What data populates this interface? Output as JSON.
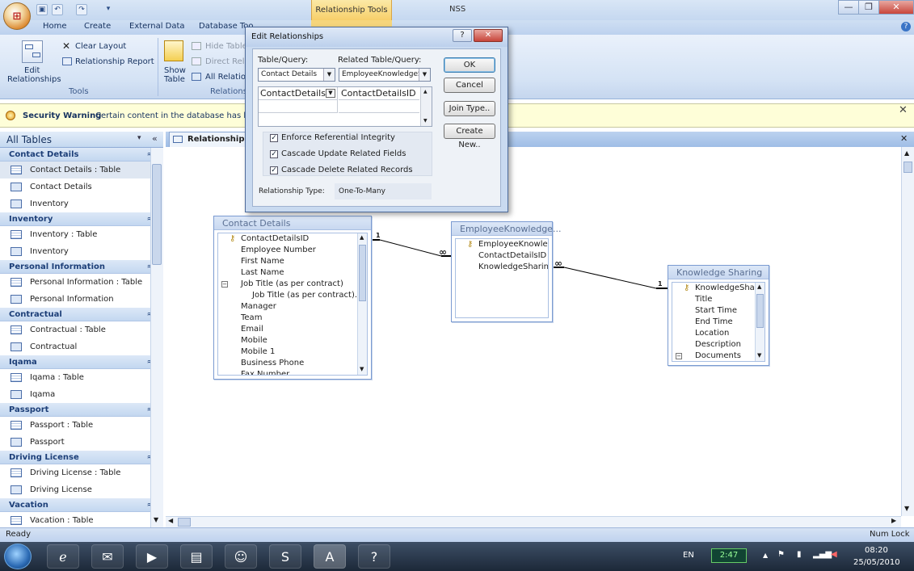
{
  "window": {
    "contextual_tab": "Relationship Tools",
    "app_title": "NSS",
    "buttons": {
      "minimize": "—",
      "restore": "❐",
      "close": "✕"
    }
  },
  "ribbon": {
    "tabs": [
      "Home",
      "Create",
      "External Data",
      "Database Too"
    ],
    "tools_group": {
      "clear_layout": "Clear Layout",
      "relationship_report": "Relationship Report",
      "edit_relationships_line1": "Edit",
      "edit_relationships_line2": "Relationships",
      "label": "Tools"
    },
    "relationships_group": {
      "hide_table": "Hide Table",
      "direct_relationships": "Direct Rela",
      "all_relationships": "All Relation",
      "show_table_line1": "Show",
      "show_table_line2": "Table",
      "label": "Relations"
    }
  },
  "security_bar": {
    "title": "Security Warning",
    "message": "Certain content in the database has been"
  },
  "nav": {
    "header": "All Tables",
    "groups": [
      {
        "name": "Contact Details",
        "items": [
          {
            "label": "Contact Details : Table",
            "kind": "table",
            "selected": true
          },
          {
            "label": "Contact Details",
            "kind": "form"
          },
          {
            "label": "Inventory",
            "kind": "form"
          }
        ]
      },
      {
        "name": "Inventory",
        "items": [
          {
            "label": "Inventory : Table",
            "kind": "table"
          },
          {
            "label": "Inventory",
            "kind": "form"
          }
        ]
      },
      {
        "name": "Personal Information",
        "items": [
          {
            "label": "Personal Information : Table",
            "kind": "table"
          },
          {
            "label": "Personal Information",
            "kind": "form"
          }
        ]
      },
      {
        "name": "Contractual",
        "items": [
          {
            "label": "Contractual : Table",
            "kind": "table"
          },
          {
            "label": "Contractual",
            "kind": "form"
          }
        ]
      },
      {
        "name": "Iqama",
        "items": [
          {
            "label": "Iqama : Table",
            "kind": "table"
          },
          {
            "label": "Iqama",
            "kind": "form"
          }
        ]
      },
      {
        "name": "Passport",
        "items": [
          {
            "label": "Passport : Table",
            "kind": "table"
          },
          {
            "label": "Passport",
            "kind": "form"
          }
        ]
      },
      {
        "name": "Driving License",
        "items": [
          {
            "label": "Driving License : Table",
            "kind": "table"
          },
          {
            "label": "Driving License",
            "kind": "form"
          }
        ]
      },
      {
        "name": "Vacation",
        "items": [
          {
            "label": "Vacation : Table",
            "kind": "table"
          }
        ]
      }
    ]
  },
  "document": {
    "tab_label": "Relationships"
  },
  "tables": {
    "contact_details": {
      "title": "Contact Details",
      "fields": [
        "ContactDetailsID",
        "Employee Number",
        "First Name",
        "Last Name",
        "Job Title (as per contract)",
        "Job Title (as per contract).Va",
        "Manager",
        "Team",
        "Email",
        "Mobile",
        "Mobile 1",
        "Business Phone",
        "Fax Number"
      ]
    },
    "employee_knowledge": {
      "title": "EmployeeKnowledge...",
      "fields": [
        "EmployeeKnowledg",
        "ContactDetailsID",
        "KnowledgeSharing"
      ]
    },
    "knowledge_sharing": {
      "title": "Knowledge Sharing",
      "fields": [
        "KnowledgeShar",
        "Title",
        "Start Time",
        "End Time",
        "Location",
        "Description",
        "Documents"
      ]
    }
  },
  "join_labels": {
    "one": "1",
    "many": "∞"
  },
  "dialog": {
    "title": "Edit Relationships",
    "help": "?",
    "close": "✕",
    "table_query_label": "Table/Query:",
    "related_table_query_label": "Related Table/Query:",
    "table_query_value": "Contact Details",
    "related_table_query_value": "EmployeeKnowledgeSh",
    "field_left": "ContactDetails",
    "field_right": "ContactDetailsID",
    "enforce_ri": "Enforce Referential Integrity",
    "cascade_update": "Cascade Update Related Fields",
    "cascade_delete": "Cascade Delete Related Records",
    "relationship_type_label": "Relationship Type:",
    "relationship_type_value": "One-To-Many",
    "ok": "OK",
    "cancel": "Cancel",
    "join_type": "Join Type..",
    "create_new": "Create New.."
  },
  "status_bar": {
    "left": "Ready",
    "right": "Num Lock"
  },
  "taskbar": {
    "language": "EN",
    "battery": "2:47",
    "time": "08:20",
    "date": "25/05/2010"
  },
  "colors": {
    "ribbon_accent": "#c5d8f0",
    "contextual_tab": "#f7cf6a",
    "nav_group_text": "#1d3f78",
    "taskbar": "#1c2838"
  }
}
